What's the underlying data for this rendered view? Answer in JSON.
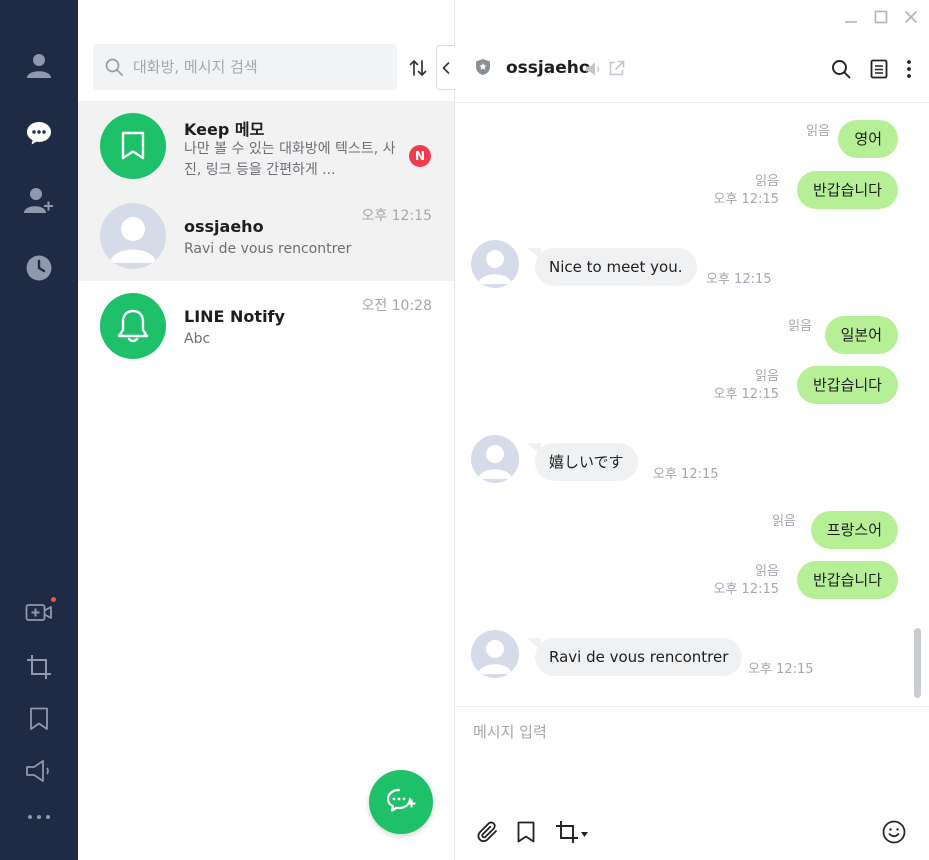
{
  "colors": {
    "rail": "#1f2a44",
    "line_green": "#1ec06a",
    "bubble_out": "#b6ef95",
    "bubble_in": "#f0f1f3",
    "badge_red": "#f03d4d"
  },
  "rail": {
    "items": [
      {
        "icon": "friends-icon"
      },
      {
        "icon": "chats-icon"
      },
      {
        "icon": "add-friend-icon"
      },
      {
        "icon": "history-clock-icon"
      },
      {
        "icon": "video-call-icon"
      },
      {
        "icon": "crop-icon"
      },
      {
        "icon": "keep-bookmark-icon"
      },
      {
        "icon": "announcement-icon"
      },
      {
        "icon": "more-dots-icon"
      }
    ]
  },
  "chat_list": {
    "search_placeholder": "대화방, 메시지 검색",
    "items": [
      {
        "name": "Keep 메모",
        "preview": "나만 볼 수 있는 대화방에 텍스트, 사진, 링크 등을 간편하게 ...",
        "time": "",
        "badge": "N"
      },
      {
        "name": "ossjaeho",
        "preview": "Ravi de vous rencontrer",
        "time": "오후 12:15",
        "badge": ""
      },
      {
        "name": "LINE Notify",
        "preview": "Abc",
        "time": "오전 10:28",
        "badge": ""
      }
    ]
  },
  "room": {
    "title": "ossjaeho",
    "composer_placeholder": "메시지 입력",
    "messages": [
      {
        "dir": "out",
        "text": "영어",
        "read": "읽음",
        "time": ""
      },
      {
        "dir": "out",
        "text": "반갑습니다",
        "read": "읽음",
        "time": "오후 12:15"
      },
      {
        "dir": "in",
        "text": "Nice to meet you.",
        "time": "오후 12:15"
      },
      {
        "dir": "out",
        "text": "일본어",
        "read": "읽음",
        "time": ""
      },
      {
        "dir": "out",
        "text": "반갑습니다",
        "read": "읽음",
        "time": "오후 12:15"
      },
      {
        "dir": "in",
        "text": "嬉しいです",
        "time": "오후 12:15"
      },
      {
        "dir": "out",
        "text": "프랑스어",
        "read": "읽음",
        "time": ""
      },
      {
        "dir": "out",
        "text": "반갑습니다",
        "read": "읽음",
        "time": "오후 12:15"
      },
      {
        "dir": "in",
        "text": "Ravi de vous rencontrer",
        "time": "오후 12:15"
      }
    ]
  }
}
